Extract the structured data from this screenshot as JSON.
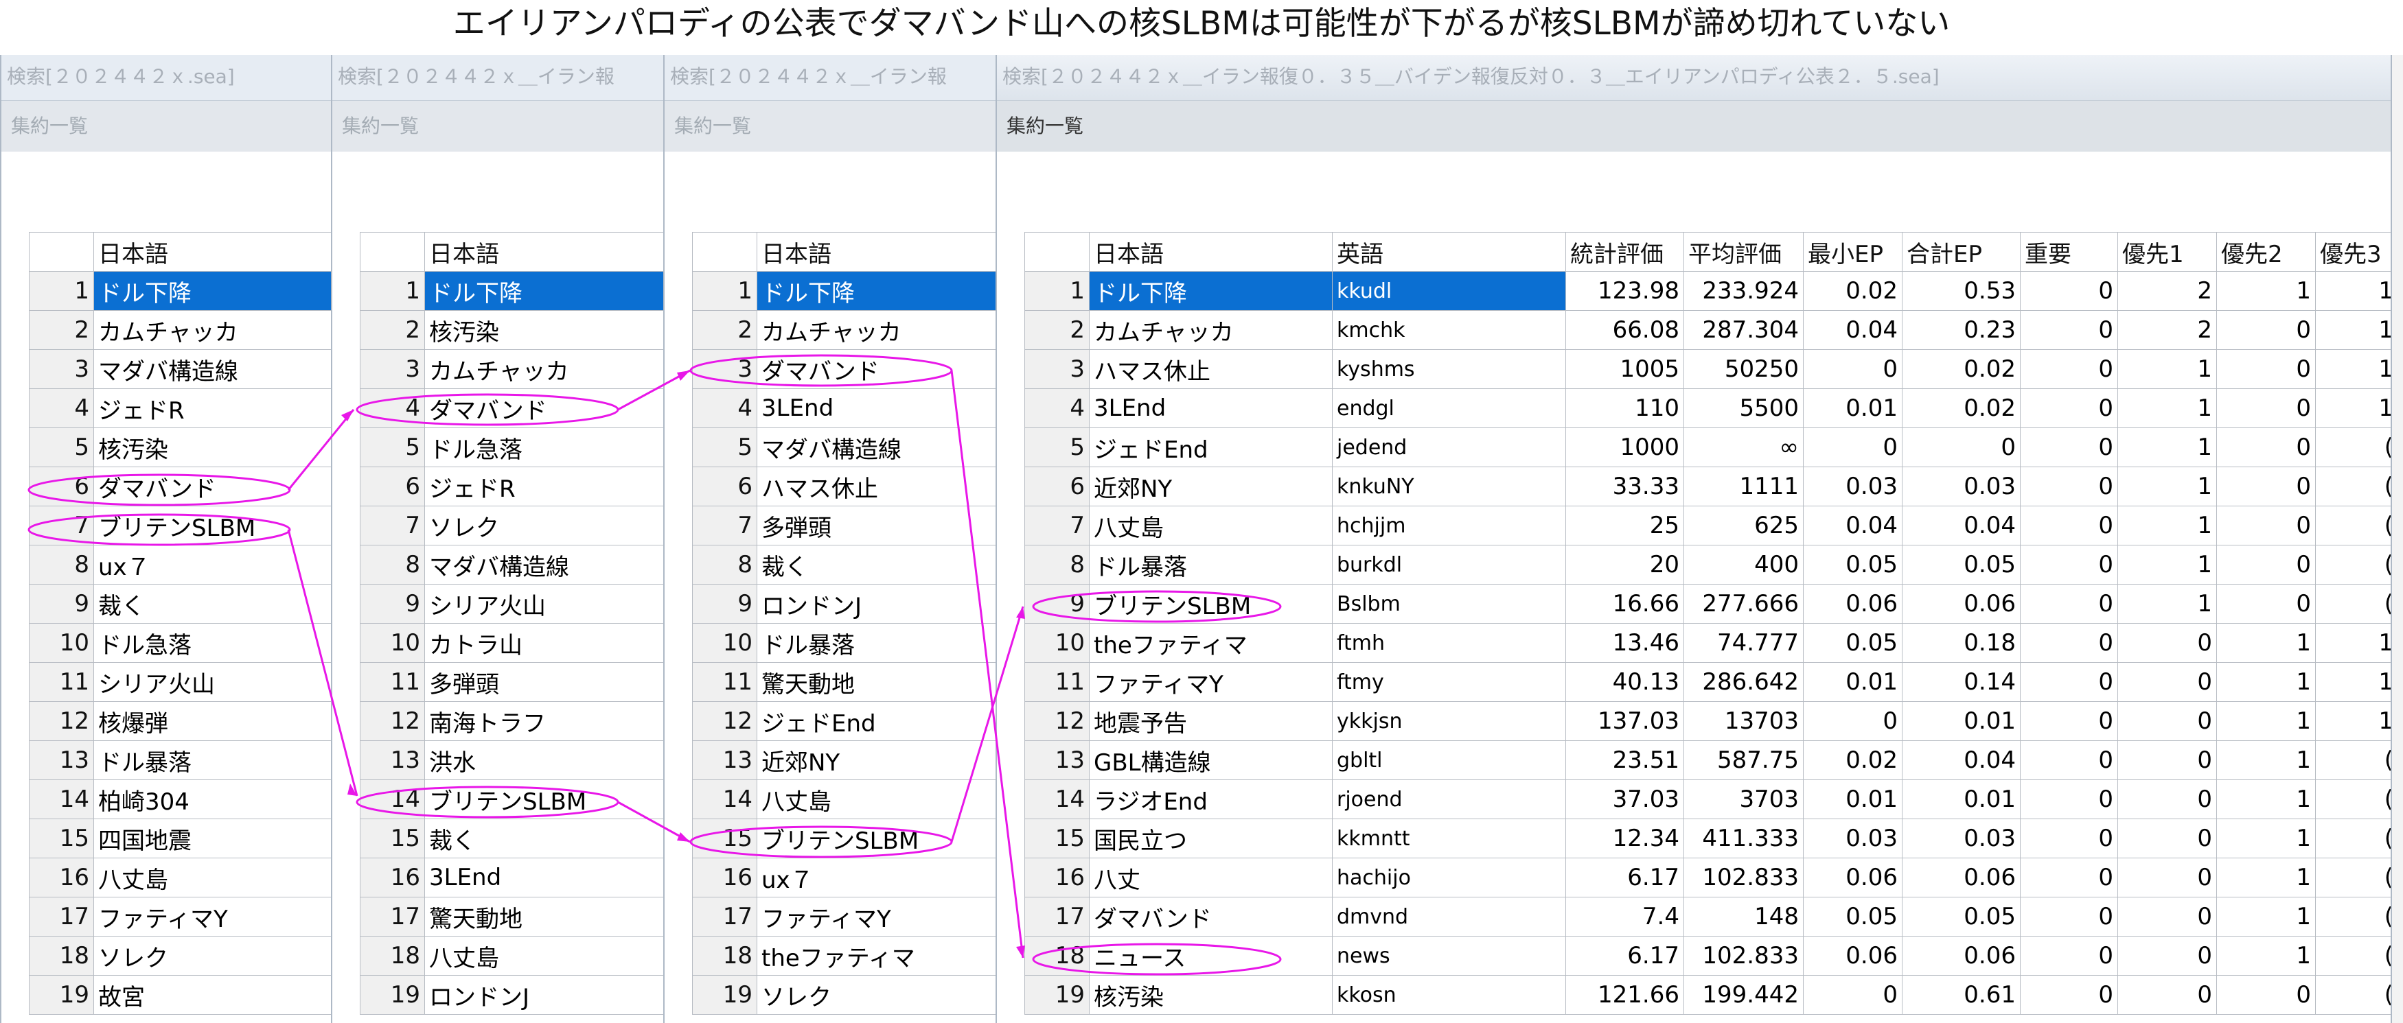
{
  "title": "エイリアンパロディの公表でダマバンド山への核SLBMは可能性が下がるが核SLBMが諦め切れていない",
  "windows": [
    {
      "titlebar": "検索[２０２４４２ｘ.sea]",
      "summary": "集約一覧",
      "col_header": "日本語",
      "rows": [
        "ドル下降",
        "カムチャッカ",
        "マダバ構造線",
        "ジェドR",
        "核汚染",
        "ダマバンド",
        "ブリテンSLBM",
        "ux７",
        "裁く",
        "ドル急落",
        "シリア火山",
        "核爆弾",
        "ドル暴落",
        "柏崎304",
        "四国地震",
        "八丈島",
        "ファティマY",
        "ソレク",
        "故宮"
      ]
    },
    {
      "titlebar": "検索[２０２４４２ｘ＿イラン報",
      "summary": "集約一覧",
      "col_header": "日本語",
      "rows": [
        "ドル下降",
        "核汚染",
        "カムチャッカ",
        "ダマバンド",
        "ドル急落",
        "ジェドR",
        "ソレク",
        "マダバ構造線",
        "シリア火山",
        "カトラ山",
        "多弾頭",
        "南海トラフ",
        "洪水",
        "ブリテンSLBM",
        "裁く",
        "3LEnd",
        "驚天動地",
        "八丈島",
        "ロンドンJ"
      ]
    },
    {
      "titlebar": "検索[２０２４４２ｘ＿イラン報",
      "summary": "集約一覧",
      "col_header": "日本語",
      "rows": [
        "ドル下降",
        "カムチャッカ",
        "ダマバンド",
        "3LEnd",
        "マダバ構造線",
        "ハマス休止",
        "多弾頭",
        "裁く",
        "ロンドンJ",
        "ドル暴落",
        "驚天動地",
        "ジェドEnd",
        "近郊NY",
        "八丈島",
        "ブリテンSLBM",
        "ux７",
        "ファティマY",
        "theファティマ",
        "ソレク"
      ]
    }
  ],
  "main": {
    "titlebar": "検索[２０２４４２ｘ＿イラン報復０．３５＿バイデン報復反対０．３＿エイリアンパロディ公表２．５.sea]",
    "summary": "集約一覧",
    "headers": [
      "日本語",
      "英語",
      "統計評価",
      "平均評価",
      "最小EP",
      "合計EP",
      "重要",
      "優先1",
      "優先2",
      "優先3"
    ],
    "rows": [
      [
        "ドル下降",
        "kkudl",
        "123.98",
        "233.924",
        "0.02",
        "0.53",
        "0",
        "2",
        "1",
        "1"
      ],
      [
        "カムチャッカ",
        "kmchk",
        "66.08",
        "287.304",
        "0.04",
        "0.23",
        "0",
        "2",
        "0",
        "1"
      ],
      [
        "ハマス休止",
        "kyshms",
        "1005",
        "50250",
        "0",
        "0.02",
        "0",
        "1",
        "0",
        "1"
      ],
      [
        "3LEnd",
        "endgl",
        "110",
        "5500",
        "0.01",
        "0.02",
        "0",
        "1",
        "0",
        "1"
      ],
      [
        "ジェドEnd",
        "jedend",
        "1000",
        "∞",
        "0",
        "0",
        "0",
        "1",
        "0",
        "("
      ],
      [
        "近郊NY",
        "knkuNY",
        "33.33",
        "1111",
        "0.03",
        "0.03",
        "0",
        "1",
        "0",
        "("
      ],
      [
        "八丈島",
        "hchjjm",
        "25",
        "625",
        "0.04",
        "0.04",
        "0",
        "1",
        "0",
        "("
      ],
      [
        "ドル暴落",
        "burkdl",
        "20",
        "400",
        "0.05",
        "0.05",
        "0",
        "1",
        "0",
        "("
      ],
      [
        "ブリテンSLBM",
        "Bslbm",
        "16.66",
        "277.666",
        "0.06",
        "0.06",
        "0",
        "1",
        "0",
        "("
      ],
      [
        "theファティマ",
        "ftmh",
        "13.46",
        "74.777",
        "0.05",
        "0.18",
        "0",
        "0",
        "1",
        "1"
      ],
      [
        "ファティマY",
        "ftmy",
        "40.13",
        "286.642",
        "0.01",
        "0.14",
        "0",
        "0",
        "1",
        "1"
      ],
      [
        "地震予告",
        "ykkjsn",
        "137.03",
        "13703",
        "0",
        "0.01",
        "0",
        "0",
        "1",
        "1"
      ],
      [
        "GBL構造線",
        "gbltl",
        "23.51",
        "587.75",
        "0.02",
        "0.04",
        "0",
        "0",
        "1",
        "("
      ],
      [
        "ラジオEnd",
        "rjoend",
        "37.03",
        "3703",
        "0.01",
        "0.01",
        "0",
        "0",
        "1",
        "("
      ],
      [
        "国民立つ",
        "kkmntt",
        "12.34",
        "411.333",
        "0.03",
        "0.03",
        "0",
        "0",
        "1",
        "("
      ],
      [
        "八丈",
        "hachijo",
        "6.17",
        "102.833",
        "0.06",
        "0.06",
        "0",
        "0",
        "1",
        "("
      ],
      [
        "ダマバンド",
        "dmvnd",
        "7.4",
        "148",
        "0.05",
        "0.05",
        "0",
        "0",
        "1",
        "("
      ],
      [
        "ニュース",
        "news",
        "6.17",
        "102.833",
        "0.06",
        "0.06",
        "0",
        "0",
        "1",
        "("
      ],
      [
        "核汚染",
        "kkosn",
        "121.66",
        "199.442",
        "0",
        "0.61",
        "0",
        "0",
        "0",
        "("
      ]
    ]
  },
  "colors": {
    "selected_row": "#0b6fd2",
    "annotation": "#e817e8",
    "grid": "#b7bcc3"
  }
}
